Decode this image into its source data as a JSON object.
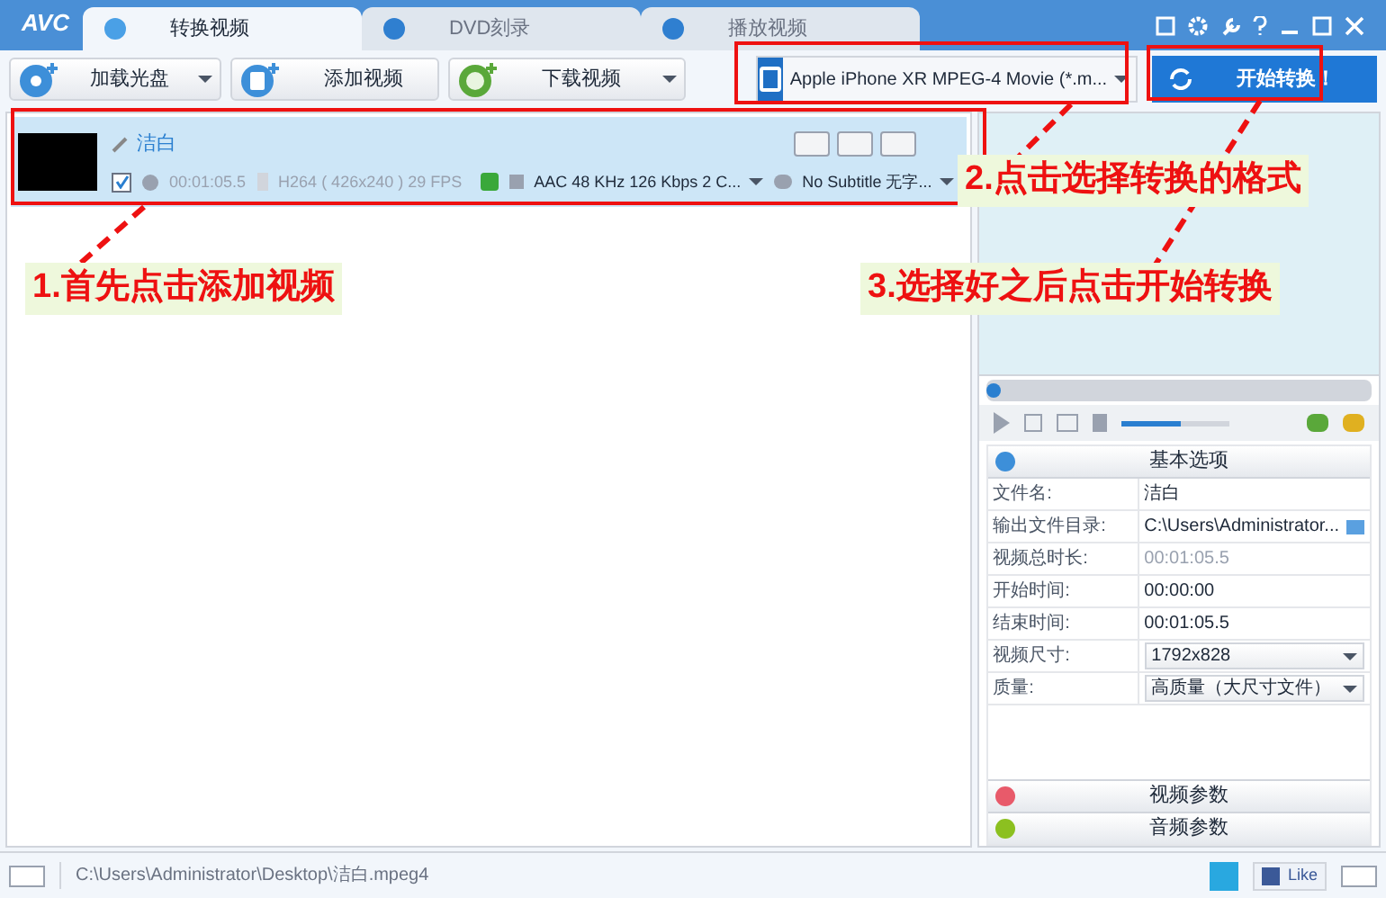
{
  "app": {
    "logo": "AVC"
  },
  "tabs": [
    {
      "label": "转换视频",
      "selected": true
    },
    {
      "label": "DVD刻录",
      "selected": false
    },
    {
      "label": "播放视频",
      "selected": false
    }
  ],
  "toolbar": [
    {
      "label": "加载光盘",
      "dropdown": true
    },
    {
      "label": "添加视频",
      "dropdown": false
    },
    {
      "label": "下载视频",
      "dropdown": true
    }
  ],
  "format": {
    "value": "Apple iPhone XR MPEG-4 Movie (*.m..."
  },
  "start_button": {
    "label": "开始转换！"
  },
  "file": {
    "name": "洁白",
    "checked": true,
    "duration": "00:01:05.5",
    "video": "H264 ( 426x240 ) 29 FPS",
    "audio": "AAC 48 KHz 126 Kbps 2 C...",
    "subtitle": "No Subtitle 无字..."
  },
  "preview": {
    "level": 0.0
  },
  "volume": {
    "level": 0.55
  },
  "options": {
    "title": "基本选项",
    "rows": [
      {
        "label": "文件名:",
        "value": "洁白",
        "kind": "text"
      },
      {
        "label": "输出文件目录:",
        "value": "C:\\Users\\Administrator...",
        "kind": "path"
      },
      {
        "label": "视频总时长:",
        "value": "00:01:05.5",
        "kind": "muted"
      },
      {
        "label": "开始时间:",
        "value": "00:00:00",
        "kind": "text"
      },
      {
        "label": "结束时间:",
        "value": "00:01:05.5",
        "kind": "text"
      },
      {
        "label": "视频尺寸:",
        "value": "1792x828",
        "kind": "dropdown"
      },
      {
        "label": "质量:",
        "value": "高质量（大尺寸文件）",
        "kind": "dropdown"
      }
    ]
  },
  "sections": [
    {
      "label": "视频参数",
      "kind": "video"
    },
    {
      "label": "音频参数",
      "kind": "audio"
    }
  ],
  "status_bar": {
    "path": "C:\\Users\\Administrator\\Desktop\\洁白.mpeg4",
    "like": "Like"
  },
  "annotations": [
    {
      "text": "1.首先点击添加视频"
    },
    {
      "text": "2.点击选择转换的格式"
    },
    {
      "text": "3.选择好之后点击开始转换"
    }
  ]
}
